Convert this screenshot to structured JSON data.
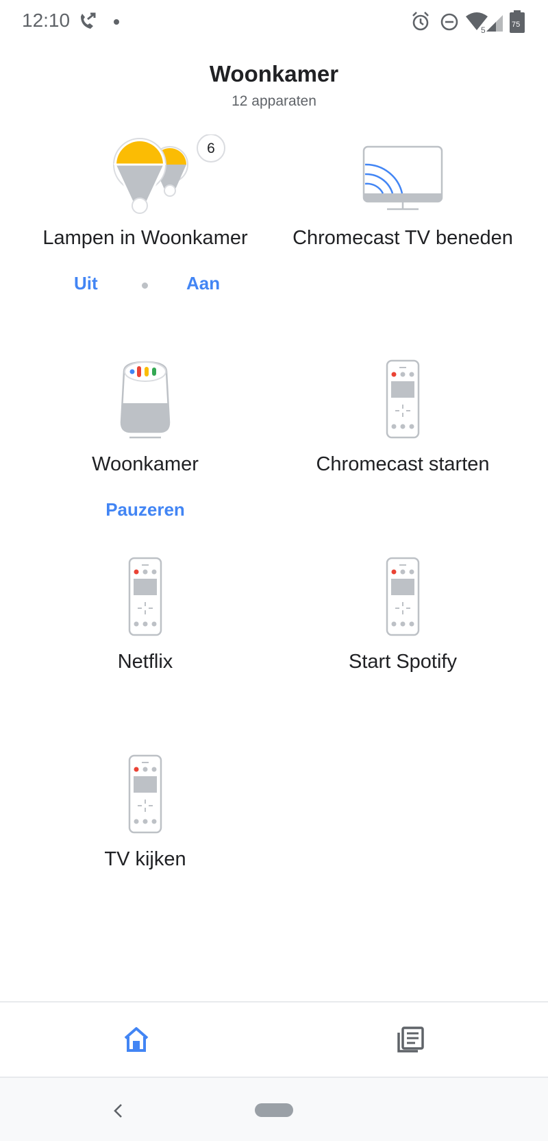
{
  "status_bar": {
    "time": "12:10",
    "battery": "75",
    "signal_label": "5",
    "icons": [
      "call-forward-icon",
      "notification-dot-icon",
      "alarm-icon",
      "do-not-disturb-icon",
      "wifi-icon",
      "cell-signal-icon",
      "battery-icon"
    ]
  },
  "header": {
    "title": "Woonkamer",
    "subtitle": "12 apparaten"
  },
  "tiles": [
    {
      "name": "Lampen in Woonkamer",
      "icon": "light-bulbs-icon",
      "badge": "6",
      "actions": [
        "Uit",
        "Aan"
      ]
    },
    {
      "name": "Chromecast TV beneden",
      "icon": "chromecast-tv-icon"
    },
    {
      "name": "Woonkamer",
      "icon": "google-home-speaker-icon",
      "actions": [
        "Pauzeren"
      ]
    },
    {
      "name": "Chromecast starten",
      "icon": "remote-icon"
    },
    {
      "name": "Netflix",
      "icon": "remote-icon"
    },
    {
      "name": "Start Spotify",
      "icon": "remote-icon"
    },
    {
      "name": "TV kijken",
      "icon": "remote-icon"
    }
  ],
  "bottom_nav": {
    "items": [
      {
        "icon": "home-icon",
        "active": true
      },
      {
        "icon": "feed-icon",
        "active": false
      }
    ]
  },
  "colors": {
    "accent": "#4285f4",
    "bulb": "#fbbc04",
    "text": "#202124",
    "muted": "#5f6368"
  }
}
